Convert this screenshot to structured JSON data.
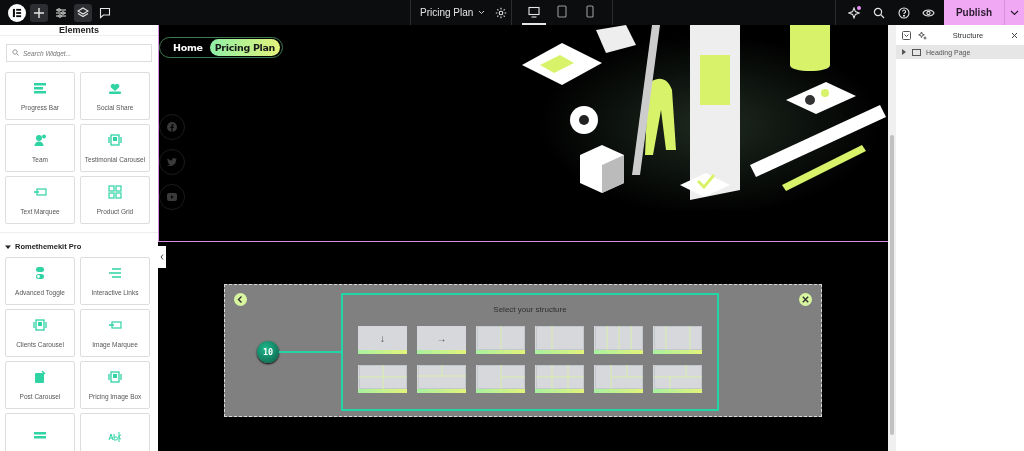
{
  "toolbar": {
    "left_buttons": [
      {
        "kind": "logo",
        "selected": false
      },
      {
        "kind": "add",
        "selected": true
      },
      {
        "kind": "sliders",
        "selected": false
      },
      {
        "kind": "layers",
        "selected": true
      },
      {
        "kind": "comment",
        "selected": false
      }
    ],
    "document": {
      "title": "Pricing Plan"
    },
    "devices": [
      {
        "kind": "desktop",
        "selected": true
      },
      {
        "kind": "tablet",
        "selected": false
      },
      {
        "kind": "mobile",
        "selected": false
      }
    ],
    "right_tools": [
      {
        "kind": "sparkle",
        "notify": true
      },
      {
        "kind": "search",
        "notify": false
      },
      {
        "kind": "help",
        "notify": false
      },
      {
        "kind": "preview",
        "notify": false
      }
    ],
    "publish": {
      "label": "Publish"
    }
  },
  "elements_panel": {
    "title": "Elements",
    "search": {
      "placeholder": "Search Widget..."
    },
    "widgets": [
      {
        "kind": "progress",
        "label": "Progress Bar"
      },
      {
        "kind": "heart",
        "label": "Social Share"
      },
      {
        "kind": "team",
        "label": "Team"
      },
      {
        "kind": "carousel",
        "label": "Testimonial Carousel"
      },
      {
        "kind": "marquee",
        "label": "Text Marquee"
      },
      {
        "kind": "grid",
        "label": "Product Grid"
      }
    ],
    "sections": [
      {
        "title": "Romethemekit Pro",
        "expanded": true,
        "widgets": [
          {
            "kind": "toggle",
            "label": "Advanced Toggle"
          },
          {
            "kind": "links",
            "label": "Interactive Links"
          },
          {
            "kind": "carousel",
            "label": "Clients Carousel"
          },
          {
            "kind": "marquee",
            "label": "Image Marquee"
          },
          {
            "kind": "post",
            "label": "Post Carousel"
          },
          {
            "kind": "carousel",
            "label": "Pricing Image Box"
          },
          {
            "kind": "list"
          },
          {
            "kind": "text"
          }
        ]
      }
    ]
  },
  "canvas": {
    "breadcrumb": [
      {
        "label": "Home",
        "selected": false
      },
      {
        "label": "Pricing Plan",
        "selected": true
      }
    ],
    "social": [
      {
        "kind": "facebook"
      },
      {
        "kind": "twitter"
      },
      {
        "kind": "youtube"
      }
    ],
    "structure_picker": {
      "title": "Select your structure",
      "step": "10",
      "presets": [
        {
          "kind": "arrow",
          "label": "↓"
        },
        {
          "kind": "arrow",
          "label": "→"
        },
        {
          "kind": "halves"
        },
        {
          "kind": "third-left"
        },
        {
          "kind": "quarters"
        },
        {
          "kind": "wide-center"
        },
        {
          "kind": "grid-2x2"
        },
        {
          "kind": "top-split"
        },
        {
          "kind": "right-split"
        },
        {
          "kind": "grid-3x2"
        },
        {
          "kind": "left-right-split"
        },
        {
          "kind": "bottom-split"
        }
      ]
    }
  },
  "structure_panel": {
    "title": "Structure",
    "items": [
      {
        "label": "Heading Page",
        "expanded": false
      }
    ]
  }
}
